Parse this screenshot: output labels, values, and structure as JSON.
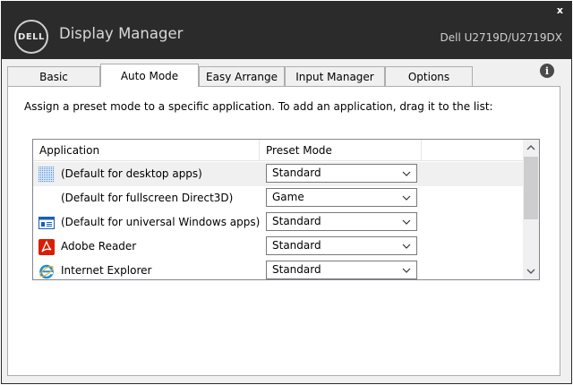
{
  "window": {
    "logo_text": "DELL",
    "title": "Display Manager",
    "model": "Dell U2719D/U2719DX",
    "close_label": "x"
  },
  "tabs": [
    {
      "label": "Basic",
      "active": false
    },
    {
      "label": "Auto Mode",
      "active": true
    },
    {
      "label": "Easy Arrange",
      "active": false
    },
    {
      "label": "Input Manager",
      "active": false
    },
    {
      "label": "Options",
      "active": false
    }
  ],
  "info_icon_label": "i",
  "instruction": "Assign a preset mode to a specific application.  To add an application, drag it to the list:",
  "list": {
    "columns": [
      "Application",
      "Preset Mode"
    ],
    "rows": [
      {
        "icon": "desktop-apps-icon",
        "name": "(Default for desktop apps)",
        "preset": "Standard",
        "selected": true
      },
      {
        "icon": "none",
        "name": "(Default for fullscreen Direct3D)",
        "preset": "Game",
        "selected": false
      },
      {
        "icon": "universal-apps-icon",
        "name": "(Default for universal Windows apps)",
        "preset": "Standard",
        "selected": false
      },
      {
        "icon": "adobe-reader-icon",
        "name": "Adobe Reader",
        "preset": "Standard",
        "selected": false
      },
      {
        "icon": "internet-explorer-icon",
        "name": "Internet Explorer",
        "preset": "Standard",
        "selected": false
      }
    ]
  },
  "colors": {
    "titlebar": "#2b2b2b",
    "selected_row": "#f0f0f0",
    "adobe_red": "#d81e05",
    "ie_blue": "#1e90d8"
  }
}
